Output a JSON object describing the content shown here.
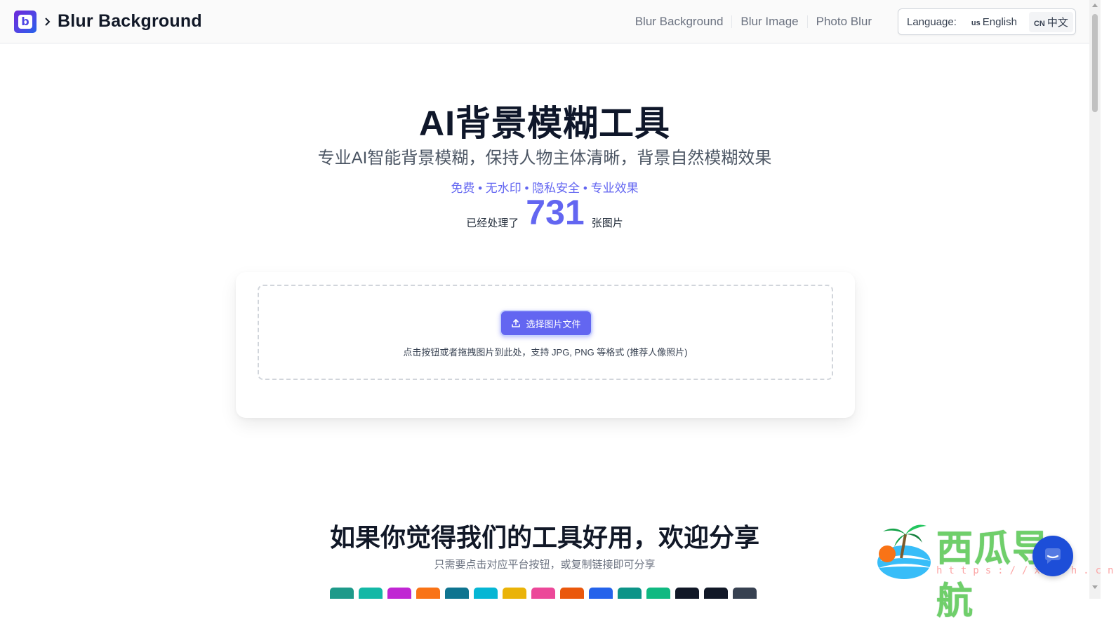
{
  "header": {
    "logo_letter": "b",
    "brand_title": "Blur Background",
    "nav": [
      {
        "label": "Blur Background"
      },
      {
        "label": "Blur Image"
      },
      {
        "label": "Photo Blur"
      }
    ],
    "language": {
      "label": "Language:",
      "options": [
        {
          "flag": "us",
          "label": "English",
          "active": false
        },
        {
          "flag": "CN",
          "label": "中文",
          "active": true
        }
      ]
    }
  },
  "hero": {
    "title": "AI背景模糊工具",
    "subtitle": "专业AI智能背景模糊，保持人物主体清晰，背景自然模糊效果",
    "tags": "免费 • 无水印 • 隐私安全 • 专业效果",
    "count_prefix": "已经处理了",
    "count_value": "731",
    "count_suffix": "张图片"
  },
  "upload": {
    "button_label": "选择图片文件",
    "hint": "点击按钮或者拖拽图片到此处，支持 JPG, PNG 等格式 (推荐人像照片)"
  },
  "share": {
    "title": "如果你觉得我们的工具好用，欢迎分享",
    "subtitle": "只需要点击对应平台按钮，或复制链接即可分享",
    "chip_colors": [
      "#1e9a8a",
      "#14b8a6",
      "#c026d3",
      "#f97316",
      "#0e7490",
      "#06b6d4",
      "#eab308",
      "#ec4899",
      "#ea580c",
      "#2563eb",
      "#0d9488",
      "#10b981",
      "#111827",
      "#111827",
      "#374151"
    ]
  },
  "watermark": {
    "text": "西瓜导航",
    "url": "https://xgdh.cn"
  },
  "colors": {
    "accent": "#6366f1",
    "chat": "#1d4ed8"
  }
}
